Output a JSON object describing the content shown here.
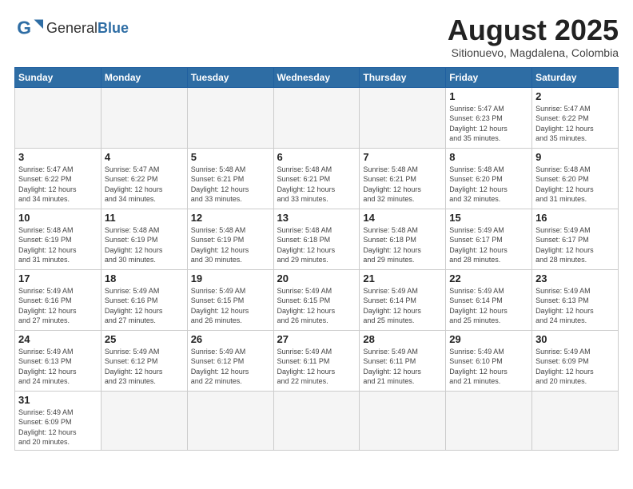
{
  "logo": {
    "text_general": "General",
    "text_blue": "Blue"
  },
  "calendar": {
    "title": "August 2025",
    "subtitle": "Sitionuevo, Magdalena, Colombia",
    "days_of_week": [
      "Sunday",
      "Monday",
      "Tuesday",
      "Wednesday",
      "Thursday",
      "Friday",
      "Saturday"
    ],
    "weeks": [
      [
        {
          "day": "",
          "info": ""
        },
        {
          "day": "",
          "info": ""
        },
        {
          "day": "",
          "info": ""
        },
        {
          "day": "",
          "info": ""
        },
        {
          "day": "",
          "info": ""
        },
        {
          "day": "1",
          "info": "Sunrise: 5:47 AM\nSunset: 6:23 PM\nDaylight: 12 hours\nand 35 minutes."
        },
        {
          "day": "2",
          "info": "Sunrise: 5:47 AM\nSunset: 6:22 PM\nDaylight: 12 hours\nand 35 minutes."
        }
      ],
      [
        {
          "day": "3",
          "info": "Sunrise: 5:47 AM\nSunset: 6:22 PM\nDaylight: 12 hours\nand 34 minutes."
        },
        {
          "day": "4",
          "info": "Sunrise: 5:47 AM\nSunset: 6:22 PM\nDaylight: 12 hours\nand 34 minutes."
        },
        {
          "day": "5",
          "info": "Sunrise: 5:48 AM\nSunset: 6:21 PM\nDaylight: 12 hours\nand 33 minutes."
        },
        {
          "day": "6",
          "info": "Sunrise: 5:48 AM\nSunset: 6:21 PM\nDaylight: 12 hours\nand 33 minutes."
        },
        {
          "day": "7",
          "info": "Sunrise: 5:48 AM\nSunset: 6:21 PM\nDaylight: 12 hours\nand 32 minutes."
        },
        {
          "day": "8",
          "info": "Sunrise: 5:48 AM\nSunset: 6:20 PM\nDaylight: 12 hours\nand 32 minutes."
        },
        {
          "day": "9",
          "info": "Sunrise: 5:48 AM\nSunset: 6:20 PM\nDaylight: 12 hours\nand 31 minutes."
        }
      ],
      [
        {
          "day": "10",
          "info": "Sunrise: 5:48 AM\nSunset: 6:19 PM\nDaylight: 12 hours\nand 31 minutes."
        },
        {
          "day": "11",
          "info": "Sunrise: 5:48 AM\nSunset: 6:19 PM\nDaylight: 12 hours\nand 30 minutes."
        },
        {
          "day": "12",
          "info": "Sunrise: 5:48 AM\nSunset: 6:19 PM\nDaylight: 12 hours\nand 30 minutes."
        },
        {
          "day": "13",
          "info": "Sunrise: 5:48 AM\nSunset: 6:18 PM\nDaylight: 12 hours\nand 29 minutes."
        },
        {
          "day": "14",
          "info": "Sunrise: 5:48 AM\nSunset: 6:18 PM\nDaylight: 12 hours\nand 29 minutes."
        },
        {
          "day": "15",
          "info": "Sunrise: 5:49 AM\nSunset: 6:17 PM\nDaylight: 12 hours\nand 28 minutes."
        },
        {
          "day": "16",
          "info": "Sunrise: 5:49 AM\nSunset: 6:17 PM\nDaylight: 12 hours\nand 28 minutes."
        }
      ],
      [
        {
          "day": "17",
          "info": "Sunrise: 5:49 AM\nSunset: 6:16 PM\nDaylight: 12 hours\nand 27 minutes."
        },
        {
          "day": "18",
          "info": "Sunrise: 5:49 AM\nSunset: 6:16 PM\nDaylight: 12 hours\nand 27 minutes."
        },
        {
          "day": "19",
          "info": "Sunrise: 5:49 AM\nSunset: 6:15 PM\nDaylight: 12 hours\nand 26 minutes."
        },
        {
          "day": "20",
          "info": "Sunrise: 5:49 AM\nSunset: 6:15 PM\nDaylight: 12 hours\nand 26 minutes."
        },
        {
          "day": "21",
          "info": "Sunrise: 5:49 AM\nSunset: 6:14 PM\nDaylight: 12 hours\nand 25 minutes."
        },
        {
          "day": "22",
          "info": "Sunrise: 5:49 AM\nSunset: 6:14 PM\nDaylight: 12 hours\nand 25 minutes."
        },
        {
          "day": "23",
          "info": "Sunrise: 5:49 AM\nSunset: 6:13 PM\nDaylight: 12 hours\nand 24 minutes."
        }
      ],
      [
        {
          "day": "24",
          "info": "Sunrise: 5:49 AM\nSunset: 6:13 PM\nDaylight: 12 hours\nand 24 minutes."
        },
        {
          "day": "25",
          "info": "Sunrise: 5:49 AM\nSunset: 6:12 PM\nDaylight: 12 hours\nand 23 minutes."
        },
        {
          "day": "26",
          "info": "Sunrise: 5:49 AM\nSunset: 6:12 PM\nDaylight: 12 hours\nand 22 minutes."
        },
        {
          "day": "27",
          "info": "Sunrise: 5:49 AM\nSunset: 6:11 PM\nDaylight: 12 hours\nand 22 minutes."
        },
        {
          "day": "28",
          "info": "Sunrise: 5:49 AM\nSunset: 6:11 PM\nDaylight: 12 hours\nand 21 minutes."
        },
        {
          "day": "29",
          "info": "Sunrise: 5:49 AM\nSunset: 6:10 PM\nDaylight: 12 hours\nand 21 minutes."
        },
        {
          "day": "30",
          "info": "Sunrise: 5:49 AM\nSunset: 6:09 PM\nDaylight: 12 hours\nand 20 minutes."
        }
      ],
      [
        {
          "day": "31",
          "info": "Sunrise: 5:49 AM\nSunset: 6:09 PM\nDaylight: 12 hours\nand 20 minutes."
        },
        {
          "day": "",
          "info": ""
        },
        {
          "day": "",
          "info": ""
        },
        {
          "day": "",
          "info": ""
        },
        {
          "day": "",
          "info": ""
        },
        {
          "day": "",
          "info": ""
        },
        {
          "day": "",
          "info": ""
        }
      ]
    ]
  }
}
